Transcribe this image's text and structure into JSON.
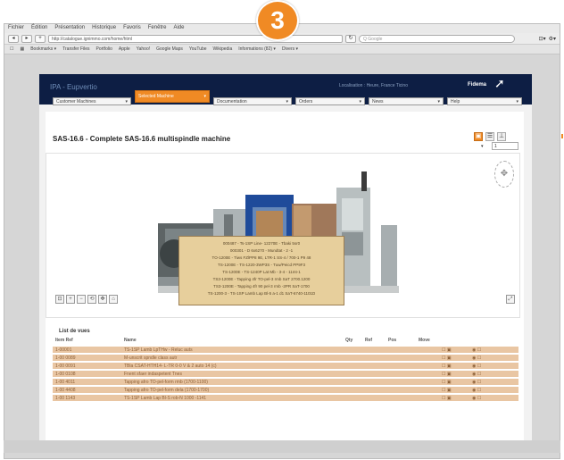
{
  "browser": {
    "menu": [
      "Fichier",
      "Édition",
      "Présentation",
      "Historique",
      "Favoris",
      "Fenêtre",
      "Aide"
    ],
    "url": "http://catalogue.ignimmo.com/home/html",
    "search": "Q Google",
    "bookmarks": [
      "Bookmarks ▾",
      "Transfer Files",
      "Portfolio",
      "Apple",
      "Yahoo!",
      "Google Maps",
      "YouTube",
      "Wikipedia",
      "Informations (82) ▾",
      "Divers ▾"
    ],
    "right": [
      "⊡▾",
      "⚙▾"
    ]
  },
  "badge": "3",
  "app": {
    "header": {
      "logo": "IPA - Eupvertio",
      "location": "Localisation : Heure, France Ticino",
      "brand": "Fidema"
    },
    "tabs": [
      "Customer Machines",
      "Selected Machine",
      "Documentation",
      "Orders",
      "News",
      "Help"
    ],
    "title": "SAS-16.6 - Complete SAS-16.6 multispindle machine",
    "sheet": "1",
    "tooltip_lines": [
      "000487 - Ts-1SP Line- 12270E - Tbaki 5sr0",
      "000301 - D 6x6270 - Mundtat - 2 -1",
      "TO-1200E - Tiws FZlPP8 9E, LTR-1 SS-4 / 700-1 P9 48",
      "TS-1200E - TS-1220-3WP3S - Tuw/Peicd PP9F3",
      "TS-1200E - TS-1240P Lat Mb - 3-4 - 11mt-1",
      "TS3-1200E - Tapping 4fr TO-pel-3 rmb SaT 2700.1200",
      "TS3-1200E - Tapping 4fr 90 pel-3 rmb -2PR SaT-1700",
      "TS-1200-3 - TS-1SP Lamb Lap Bl-5 a-1 d1 SaT-6740-1101D"
    ],
    "list": {
      "title": "List de vues",
      "headers": [
        "Item Ref",
        "Name",
        "Qty",
        "Ref",
        "Pos",
        "Move",
        "",
        ""
      ],
      "rows": [
        {
          "ref": "1-00001",
          "name": "TS-1SP Lamb LpTHw - Reluc auts",
          "qty": "",
          "r": "",
          "pos": "",
          "move": "",
          "a": "☐ ▣",
          "b": "◉ ☐"
        },
        {
          "ref": "1-00 0089",
          "name": "M-unscrit spndle class autr",
          "qty": "",
          "r": "",
          "pos": "",
          "move": "",
          "a": "☐ ▣",
          "b": "◉ ☐"
        },
        {
          "ref": "1-00 0091",
          "name": "TBla CSAT-HTH14- L-TR 0-0 V & 2 auto 14 (c)",
          "qty": "",
          "r": "",
          "pos": "",
          "move": "",
          "a": "☐ ▣",
          "b": "◉ ☐"
        },
        {
          "ref": "1-00 0108",
          "name": "Fnent sfaer indaspetent Tnes",
          "qty": "",
          "r": "",
          "pos": "",
          "move": "",
          "a": "☐ ▣",
          "b": "◉ ☐"
        },
        {
          "ref": "1-00 4011",
          "name": "Tapping afro TO-pel-form rmb (1700-1100)",
          "qty": "",
          "r": "",
          "pos": "",
          "move": "",
          "a": "☐ ▣",
          "b": "◉ ☐"
        },
        {
          "ref": "1-00 4408",
          "name": "Tapping afro TO-pel-form dela (1700-1700)",
          "qty": "",
          "r": "",
          "pos": "",
          "move": "",
          "a": "☐ ▣",
          "b": "◉ ☐"
        },
        {
          "ref": "1-00 1143",
          "name": "TS-1SP Lamb Lap Bl-S rob-N 1000 -1141",
          "qty": "",
          "r": "",
          "pos": "",
          "move": "",
          "a": "☐ ▣",
          "b": "◉ ☐"
        }
      ]
    }
  },
  "colors": {
    "accent": "#f08a24",
    "header": "#0d1e44",
    "row": "#e9c6a3",
    "tooltip": "#e7cf9c"
  }
}
